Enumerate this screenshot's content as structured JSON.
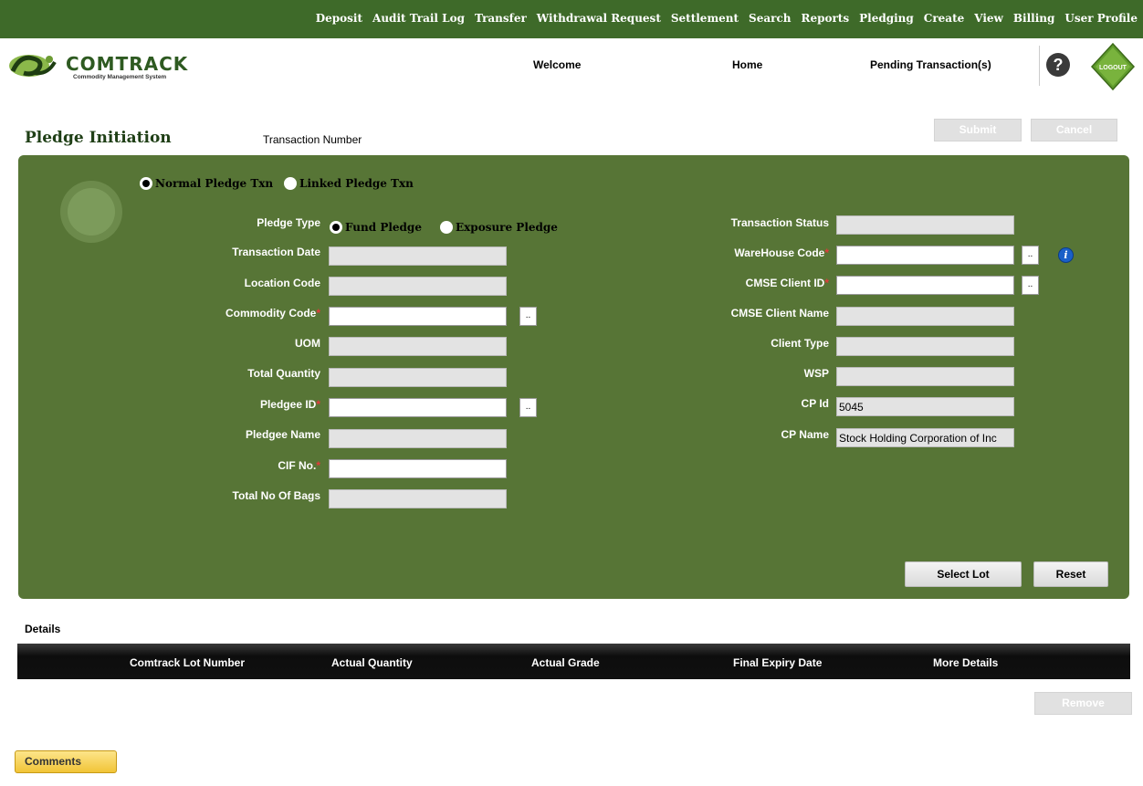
{
  "top_nav": [
    "Deposit",
    "Audit Trail Log",
    "Transfer",
    "Withdrawal Request",
    "Settlement",
    "Search",
    "Reports",
    "Pledging",
    "Create",
    "View",
    "Billing",
    "User Profile"
  ],
  "header": {
    "brand": "COMTRACK",
    "tagline": "Commodity Management System",
    "welcome": "Welcome",
    "home": "Home",
    "pending": "Pending Transaction(s)",
    "help": "?",
    "logout": "LOGOUT"
  },
  "page": {
    "title": "Pledge Initiation",
    "transaction_number_label": "Transaction Number",
    "submit": "Submit",
    "cancel": "Cancel"
  },
  "form": {
    "txn_type": {
      "normal": "Normal Pledge Txn",
      "linked": "Linked Pledge Txn",
      "selected": "normal"
    },
    "pledge_type": {
      "label": "Pledge Type",
      "fund": "Fund Pledge",
      "exposure": "Exposure Pledge",
      "selected": "fund"
    },
    "left_fields": {
      "transaction_date": {
        "label": "Transaction Date",
        "value": ""
      },
      "location_code": {
        "label": "Location Code",
        "value": ""
      },
      "commodity_code": {
        "label": "Commodity Code",
        "value": ""
      },
      "uom": {
        "label": "UOM",
        "value": ""
      },
      "total_quantity": {
        "label": "Total Quantity",
        "value": ""
      },
      "pledgee_id": {
        "label": "Pledgee ID",
        "value": ""
      },
      "pledgee_name": {
        "label": "Pledgee Name",
        "value": ""
      },
      "cif_no": {
        "label": "CIF No.",
        "value": ""
      },
      "total_bags": {
        "label": "Total No Of Bags",
        "value": ""
      }
    },
    "right_fields": {
      "transaction_status": {
        "label": "Transaction Status",
        "value": ""
      },
      "warehouse_code": {
        "label": "WareHouse Code",
        "value": ""
      },
      "cmse_client_id": {
        "label": "CMSE Client ID",
        "value": ""
      },
      "cmse_client_name": {
        "label": "CMSE Client Name",
        "value": ""
      },
      "client_type": {
        "label": "Client Type",
        "value": ""
      },
      "wsp": {
        "label": "WSP",
        "value": ""
      },
      "cp_id": {
        "label": "CP Id",
        "value": "5045"
      },
      "cp_name": {
        "label": "CP Name",
        "value": "Stock Holding Corporation of Inc"
      }
    },
    "required_mark": "*",
    "lookup": "..",
    "info": "i",
    "select_lot": "Select Lot",
    "reset": "Reset"
  },
  "details": {
    "label": "Details",
    "columns": [
      "Comtrack Lot Number",
      "Actual Quantity",
      "Actual Grade",
      "Final Expiry Date",
      "More Details"
    ],
    "remove": "Remove"
  },
  "comments": "Comments",
  "colors": {
    "nav_bg": "#3e6a29",
    "panel_bg": "#577536",
    "title": "#1f3f16"
  }
}
